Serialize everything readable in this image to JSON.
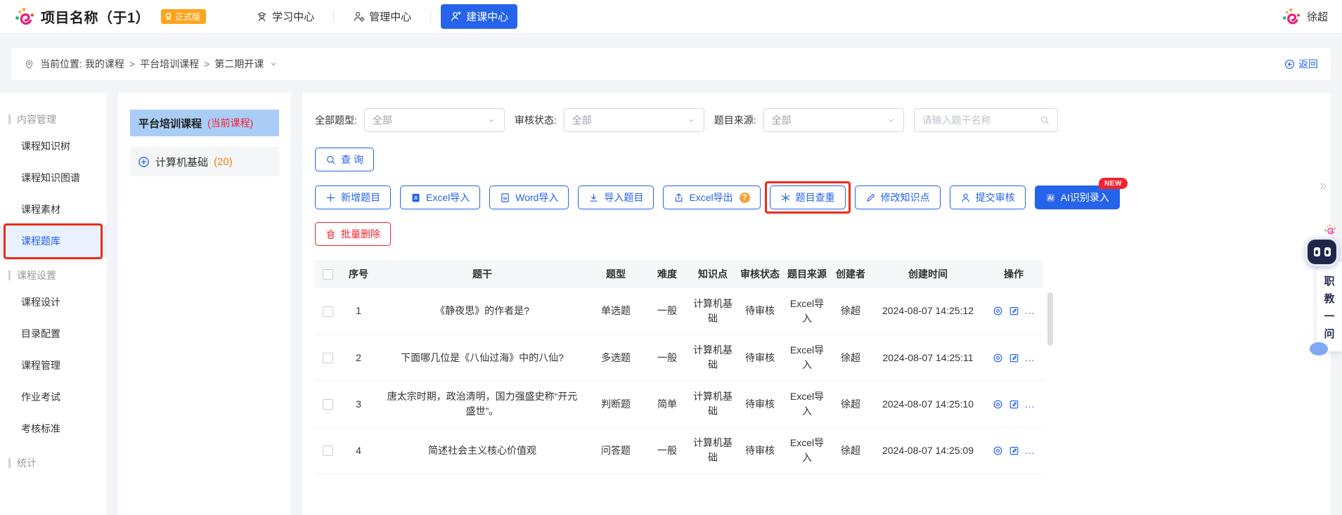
{
  "colors": {
    "primary": "#2563eb",
    "danger": "#f5222d",
    "annotation": "#ee2b18",
    "count_orange": "#f77c0c",
    "version_badge_bg": "#ffa41d",
    "current_course_bg": "#a9cdf6"
  },
  "header": {
    "brand": "项目名称（于1）",
    "version_badge": "正式版",
    "nav": [
      {
        "label": "学习中心",
        "icon": "grad-person",
        "active": false
      },
      {
        "label": "管理中心",
        "icon": "person-gear",
        "active": false
      },
      {
        "label": "建课中心",
        "icon": "person-edit",
        "active": true
      }
    ],
    "user": "徐超"
  },
  "breadcrumb": {
    "prefix": "当前位置:",
    "separator": ">",
    "items": [
      "我的课程",
      "平台培训课程",
      "第二期开课"
    ],
    "back_label": "返回"
  },
  "sidebar": {
    "sections": [
      {
        "title": "内容管理",
        "items": [
          {
            "label": "课程知识树"
          },
          {
            "label": "课程知识图谱"
          },
          {
            "label": "课程素材"
          },
          {
            "label": "课程题库",
            "active": true,
            "annotated": true
          }
        ]
      },
      {
        "title": "课程设置",
        "items": [
          {
            "label": "课程设计"
          },
          {
            "label": "目录配置"
          },
          {
            "label": "课程管理"
          },
          {
            "label": "作业考试"
          },
          {
            "label": "考核标准"
          }
        ]
      },
      {
        "title": "统计",
        "items": []
      }
    ]
  },
  "course_tree": {
    "current_name": "平台培训课程",
    "current_tag": "(当前课程)",
    "node_label": "计算机基础",
    "node_count": "(20)"
  },
  "filters": [
    {
      "label": "全部题型:",
      "value": "全部"
    },
    {
      "label": "审核状态:",
      "value": "全部"
    },
    {
      "label": "题目来源:",
      "value": "全部"
    }
  ],
  "search": {
    "placeholder": "请输入题干名称"
  },
  "toolbar": {
    "query_label": "查 询",
    "buttons": [
      {
        "label": "新增题目",
        "icon": "plus"
      },
      {
        "label": "Excel导入",
        "icon": "excel-file"
      },
      {
        "label": "Word导入",
        "icon": "word-file"
      },
      {
        "label": "导入题目",
        "icon": "download"
      },
      {
        "label": "Excel导出",
        "icon": "export",
        "help": "?"
      },
      {
        "label": "题目查重",
        "icon": "sparkle",
        "annotated": true
      },
      {
        "label": "修改知识点",
        "icon": "pencil"
      },
      {
        "label": "提交审核",
        "icon": "person"
      },
      {
        "label": "AI识别录入",
        "icon": "ai-chip",
        "primary": true,
        "badge": "NEW"
      }
    ],
    "delete_label": "批量删除"
  },
  "table": {
    "columns": [
      "序号",
      "题干",
      "题型",
      "难度",
      "知识点",
      "审核状态",
      "题目来源",
      "创建者",
      "创建时间",
      "操作"
    ],
    "rows": [
      {
        "no": "1",
        "stem": "《静夜思》的作者是?",
        "type": "单选题",
        "difficulty": "一般",
        "knowledge": "计算机基础",
        "status": "待审核",
        "source": "Excel导入",
        "creator": "徐超",
        "created": "2024-08-07 14:25:12"
      },
      {
        "no": "2",
        "stem": "下面哪几位是《八仙过海》中的八仙?",
        "type": "多选题",
        "difficulty": "一般",
        "knowledge": "计算机基础",
        "status": "待审核",
        "source": "Excel导入",
        "creator": "徐超",
        "created": "2024-08-07 14:25:11"
      },
      {
        "no": "3",
        "stem": "唐太宗时期，政治清明，国力强盛史称“开元盛世”。",
        "type": "判断题",
        "difficulty": "简单",
        "knowledge": "计算机基础",
        "status": "待审核",
        "source": "Excel导入",
        "creator": "徐超",
        "created": "2024-08-07 14:25:10"
      },
      {
        "no": "4",
        "stem": "简述社会主义核心价值观",
        "type": "问答题",
        "difficulty": "一般",
        "knowledge": "计算机基础",
        "status": "待审核",
        "source": "Excel导入",
        "creator": "徐超",
        "created": "2024-08-07 14:25:09"
      }
    ],
    "ops_more": "..."
  },
  "assistant": {
    "label": "职教一问"
  }
}
